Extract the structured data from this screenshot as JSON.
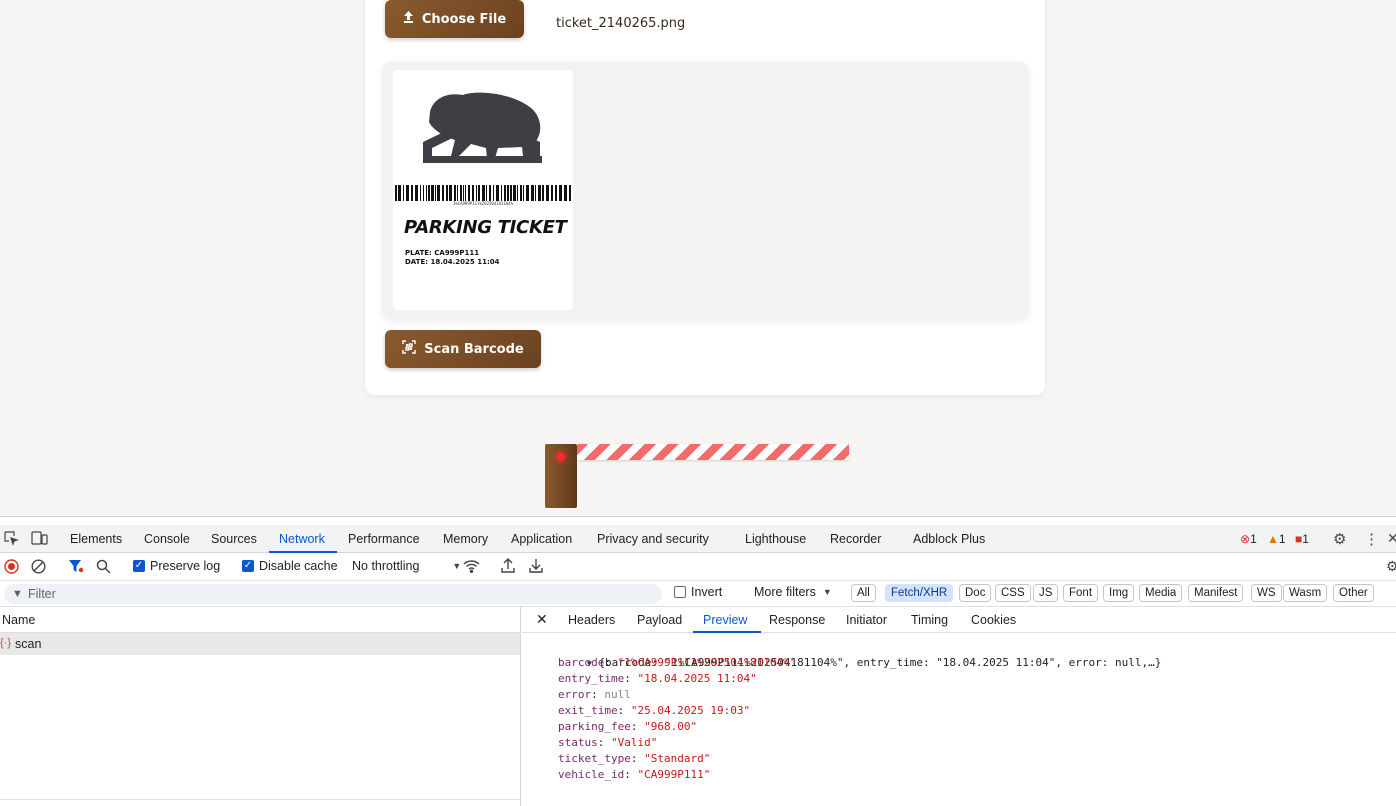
{
  "upload": {
    "choose_label": "Choose File",
    "file_name": "ticket_2140265.png",
    "scan_label": "Scan Barcode"
  },
  "ticket": {
    "barcode_text": "1%CA999P111%202504181104%",
    "title": "PARKING TICKET",
    "plate": "PLATE: CA999P111",
    "date": "DATE: 18.04.2025 11:04"
  },
  "devtools": {
    "tabs": [
      "Elements",
      "Console",
      "Sources",
      "Network",
      "Performance",
      "Memory",
      "Application",
      "Privacy and security",
      "Lighthouse",
      "Recorder",
      "Adblock Plus"
    ],
    "active_tab": "Network",
    "badges": {
      "errors": "1",
      "warnings": "1",
      "issues": "1"
    },
    "toolbar": {
      "preserve_log": "Preserve log",
      "disable_cache": "Disable cache",
      "throttling": "No throttling"
    },
    "filter": {
      "placeholder": "Filter",
      "invert": "Invert",
      "more_filters": "More filters",
      "chips": [
        "All",
        "Fetch/XHR",
        "Doc",
        "CSS",
        "JS",
        "Font",
        "Img",
        "Media",
        "Manifest",
        "WS",
        "Wasm",
        "Other"
      ],
      "active_chip": "Fetch/XHR"
    },
    "requests": {
      "header": "Name",
      "items": [
        "scan"
      ]
    },
    "detail_tabs": [
      "Headers",
      "Payload",
      "Preview",
      "Response",
      "Initiator",
      "Timing",
      "Cookies"
    ],
    "active_detail_tab": "Preview",
    "preview": {
      "summary": "{barcode: \"1%CA999P111%202504181104%\", entry_time: \"18.04.2025 11:04\", error: null,…}",
      "fields": [
        {
          "key": "barcode",
          "value": "\"1%CA999P111%202504181104%\"",
          "kind": "str"
        },
        {
          "key": "entry_time",
          "value": "\"18.04.2025 11:04\"",
          "kind": "str"
        },
        {
          "key": "error",
          "value": "null",
          "kind": "null"
        },
        {
          "key": "exit_time",
          "value": "\"25.04.2025 19:03\"",
          "kind": "str"
        },
        {
          "key": "parking_fee",
          "value": "\"968.00\"",
          "kind": "str"
        },
        {
          "key": "status",
          "value": "\"Valid\"",
          "kind": "str"
        },
        {
          "key": "ticket_type",
          "value": "\"Standard\"",
          "kind": "str"
        },
        {
          "key": "vehicle_id",
          "value": "\"CA999P111\"",
          "kind": "str"
        }
      ]
    }
  },
  "colors": {
    "brown": "#7a4c24",
    "accent_blue": "#0b57d0",
    "gate_red": "#f36a6a"
  },
  "icons": [
    "upload-icon",
    "qr-scan-icon",
    "capybara-logo",
    "inspect-icon",
    "device-icon",
    "settings-gear-icon",
    "more-vert-icon",
    "close-icon",
    "record-icon",
    "clear-icon",
    "filter-icon",
    "search-icon",
    "wifi-icon",
    "upload-arrow-icon",
    "download-arrow-icon",
    "chevron-down-icon",
    "xhr-icon"
  ]
}
